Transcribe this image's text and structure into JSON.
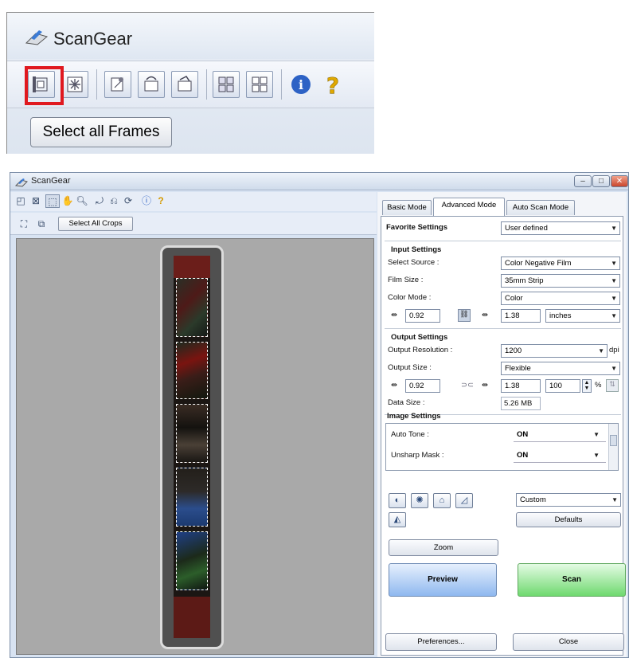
{
  "zoom": {
    "title": "ScanGear",
    "select_all_frames_label": "Select all Frames",
    "highlight_color": "#e0191f"
  },
  "window": {
    "title": "ScanGear",
    "caption_buttons": [
      "minimize-icon",
      "maximize-icon",
      "close-icon"
    ]
  },
  "toolbar": {
    "icons": [
      "frame-adjust-icon",
      "clear-icon",
      "crop-icon",
      "rotate-icon",
      "zoom-icon",
      "rotate-left-icon",
      "rotate-right-icon",
      "mirror-icon",
      "info-icon",
      "help-icon"
    ],
    "select_all_crops_label": "Select All Crops"
  },
  "tabs": [
    "Basic Mode",
    "Advanced Mode",
    "Auto Scan Mode"
  ],
  "active_tab": "Advanced Mode",
  "favorite": {
    "label": "Favorite Settings",
    "value": "User defined"
  },
  "input": {
    "header": "Input Settings",
    "select_source_label": "Select Source :",
    "select_source_value": "Color Negative Film",
    "film_size_label": "Film Size :",
    "film_size_value": "35mm Strip",
    "color_mode_label": "Color Mode :",
    "color_mode_value": "Color",
    "width": "0.92",
    "height": "1.38",
    "unit": "inches"
  },
  "output": {
    "header": "Output Settings",
    "resolution_label": "Output Resolution :",
    "resolution_value": "1200",
    "dpi": "dpi",
    "size_label": "Output Size :",
    "size_value": "Flexible",
    "width": "0.92",
    "height": "1.38",
    "scale": "100",
    "percent": "%",
    "data_size_label": "Data Size :",
    "data_size_value": "5.26 MB"
  },
  "image": {
    "header": "Image Settings",
    "rows": [
      {
        "label": "Auto Tone :",
        "value": "ON"
      },
      {
        "label": "Unsharp Mask :",
        "value": "ON"
      }
    ],
    "tone_preset": "Custom",
    "defaults_label": "Defaults"
  },
  "buttons": {
    "zoom": "Zoom",
    "preview": "Preview",
    "scan": "Scan",
    "preferences": "Preferences...",
    "close": "Close"
  }
}
